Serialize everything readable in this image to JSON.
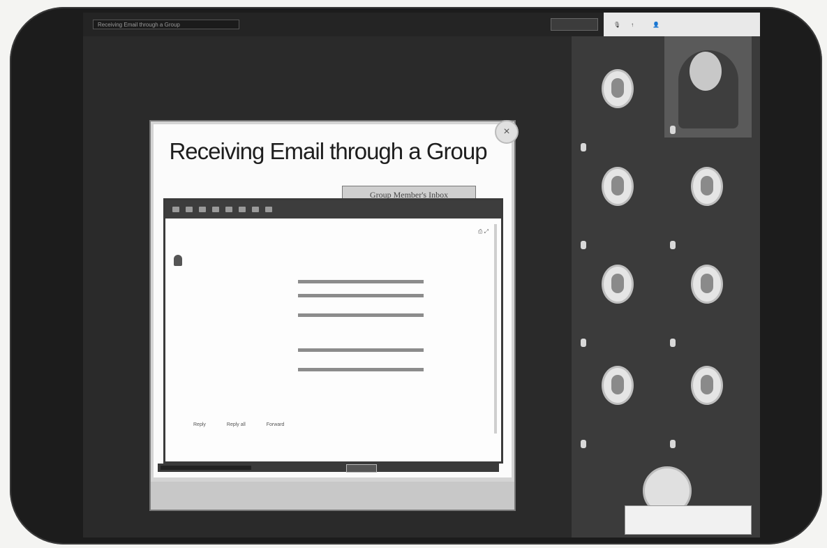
{
  "meeting": {
    "title": "Receiving Email through a Group",
    "view_label": "",
    "topbar": {
      "mic_label": "",
      "share_label": "",
      "account_label": ""
    }
  },
  "slide": {
    "title": "Receiving Email through a Group",
    "callout": "Group Member's Inbox",
    "close_glyph": "×",
    "footer": ""
  },
  "email": {
    "subject": "",
    "sender_name": "",
    "sender_address": "",
    "date": "",
    "headers": [
      {
        "key": "",
        "mid": "",
        "extra": ""
      },
      {
        "key": "",
        "mid": "",
        "extra": ""
      },
      {
        "key": "",
        "mid": "",
        "extra": ""
      },
      {
        "key": "",
        "mid": "",
        "extra": ""
      },
      {
        "key": "",
        "mid": "",
        "extra": ""
      }
    ],
    "actions": [
      "Reply",
      "Reply all",
      "Forward"
    ]
  },
  "participants": [
    {
      "name": ""
    },
    {
      "name": ""
    },
    {
      "name": ""
    },
    {
      "name": ""
    },
    {
      "name": ""
    },
    {
      "name": ""
    },
    {
      "name": ""
    },
    {
      "name": ""
    },
    {
      "name": ""
    }
  ],
  "toast": {
    "title": "",
    "body": ""
  },
  "colors": {
    "bezel": "#1c1c1c",
    "sidebar": "#3b3b3b",
    "slide_bg": "#fbfbfb"
  }
}
